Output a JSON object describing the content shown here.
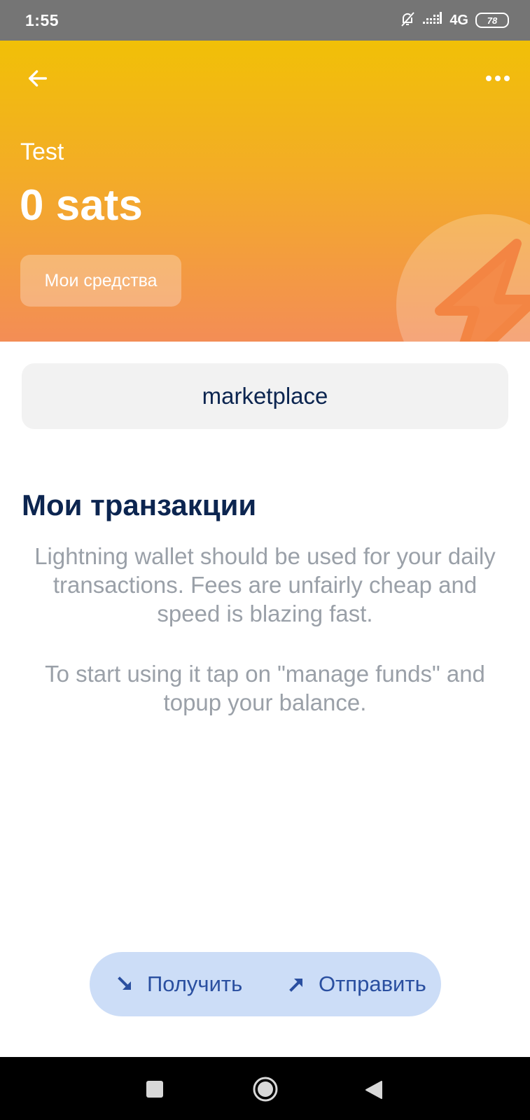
{
  "status_bar": {
    "time": "1:55",
    "network": "4G",
    "battery": "78",
    "icons": [
      "bell-off-icon",
      "signal-icon",
      "battery-icon"
    ]
  },
  "header": {
    "back_icon": "arrow-left-icon",
    "more_icon": "more-horizontal-icon",
    "wallet_label": "Test",
    "balance": "0 sats",
    "funds_button_label": "Мои средства",
    "decor_icon": "lightning-bolt-icon",
    "gradient_colors": [
      "#f1c007",
      "#f3ac27",
      "#f38d56"
    ]
  },
  "marketplace": {
    "label": "marketplace"
  },
  "transactions": {
    "title": "Мои транзакции",
    "empty_text_1": "Lightning wallet should be used for your daily transactions. Fees are unfairly cheap and speed is blazing fast.",
    "empty_text_2": "To start using it tap on \"manage funds\" and topup your balance."
  },
  "actions": {
    "receive_label": "Получить",
    "receive_icon": "arrow-down-right-icon",
    "send_label": "Отправить",
    "send_icon": "arrow-up-right-icon",
    "pill_color": "#ccddf7",
    "text_color": "#2a4fa0"
  },
  "nav_bar": {
    "items": [
      "recent-apps-icon",
      "home-icon",
      "back-icon"
    ]
  },
  "colors": {
    "title": "#0c2550",
    "muted_text": "#9aa0a8",
    "marketplace_bg": "#f2f2f2"
  }
}
